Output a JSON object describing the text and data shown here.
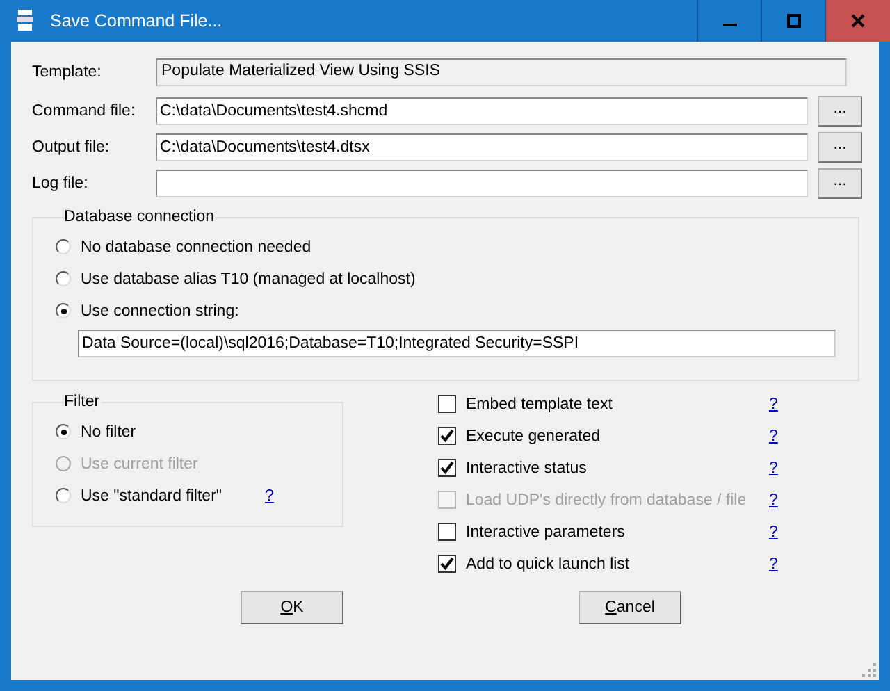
{
  "window": {
    "title": "Save Command File..."
  },
  "fields": [
    {
      "label": "Template:",
      "value": "Populate Materialized View Using SSIS",
      "kind": "readonly"
    },
    {
      "label": "Command file:",
      "value": "C:\\data\\Documents\\test4.shcmd",
      "kind": "file",
      "browse": "..."
    },
    {
      "label": "Output file:",
      "value": "C:\\data\\Documents\\test4.dtsx",
      "kind": "file",
      "browse": "..."
    },
    {
      "label": "Log file:",
      "kind": "file",
      "browse": "..."
    }
  ],
  "database_connection": {
    "title": "Database connection",
    "options": [
      {
        "label": "No database connection needed",
        "selected": false
      },
      {
        "label": "Use database alias T10 (managed at localhost)",
        "selected": false
      },
      {
        "label": "Use connection string:",
        "selected": true
      }
    ],
    "connection_string": "Data Source=(local)\\sql2016;Database=T10;Integrated Security=SSPI"
  },
  "filter": {
    "title": "Filter",
    "options": [
      {
        "label": "No filter",
        "selected": true,
        "disabled": false
      },
      {
        "label": "Use current filter",
        "selected": false,
        "disabled": true
      },
      {
        "label": "Use \"standard filter\"",
        "selected": false,
        "disabled": false,
        "help": "?"
      }
    ]
  },
  "options": [
    {
      "label": "Embed template text",
      "checked": false,
      "disabled": false,
      "help": "?"
    },
    {
      "label": "Execute generated",
      "checked": true,
      "disabled": false,
      "help": "?"
    },
    {
      "label": "Interactive status",
      "checked": true,
      "disabled": false,
      "help": "?"
    },
    {
      "label": "Load UDP's directly from database / file",
      "checked": false,
      "disabled": true,
      "help": "?"
    },
    {
      "label": "Interactive parameters",
      "checked": false,
      "disabled": false,
      "help": "?"
    },
    {
      "label": "Add to quick launch list",
      "checked": true,
      "disabled": false,
      "help": "?"
    }
  ],
  "buttons": [
    {
      "label": "OK"
    },
    {
      "label": "Cancel"
    }
  ]
}
